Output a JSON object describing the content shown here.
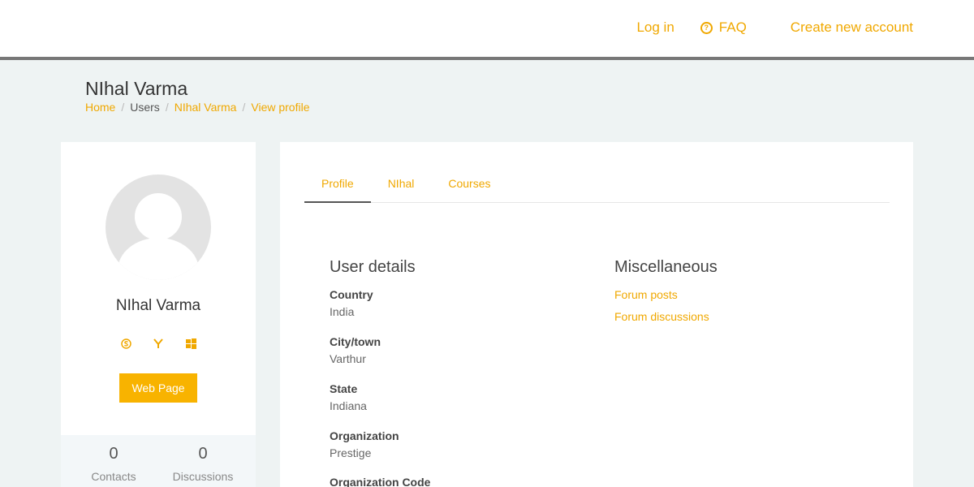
{
  "nav": {
    "login": "Log in",
    "faq": "FAQ",
    "create_account": "Create new account",
    "faq_icon": "question-circle-icon"
  },
  "page": {
    "title": "NIhal Varma",
    "breadcrumb": [
      "Home",
      "Users",
      "NIhal Varma",
      "View profile"
    ]
  },
  "profile_card": {
    "name": "NIhal Varma",
    "social_icons": [
      "skype-icon",
      "yahoo-icon",
      "windows-icon"
    ],
    "web_page_label": "Web Page",
    "stats": [
      {
        "value": "0",
        "label": "Contacts"
      },
      {
        "value": "0",
        "label": "Discussions"
      }
    ]
  },
  "tabs": [
    "Profile",
    "NIhal",
    "Courses"
  ],
  "user_details": {
    "title": "User details",
    "fields": [
      {
        "label": "Country",
        "value": "India"
      },
      {
        "label": "City/town",
        "value": "Varthur"
      },
      {
        "label": "State",
        "value": "Indiana"
      },
      {
        "label": "Organization",
        "value": "Prestige"
      },
      {
        "label": "Organization Code",
        "value": ""
      }
    ]
  },
  "misc": {
    "title": "Miscellaneous",
    "links": [
      "Forum posts",
      "Forum discussions"
    ]
  },
  "colors": {
    "accent": "#f0a800",
    "button": "#f8b300",
    "background": "#eef3f3"
  }
}
